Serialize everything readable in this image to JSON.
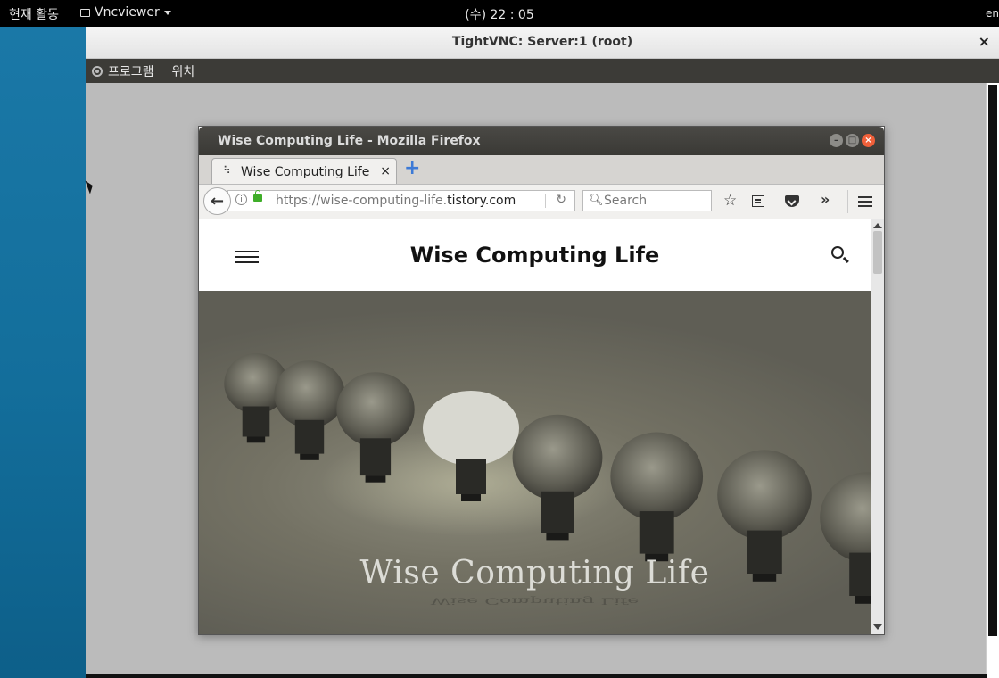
{
  "topbar": {
    "activities": "현재 활동",
    "app_menu": "Vncviewer",
    "clock": "(수) 22 : 05",
    "locale": "en"
  },
  "vnc": {
    "title": "TightVNC: Server:1 (root)",
    "close": "×",
    "panel_programs": "프로그램",
    "panel_places": "위치"
  },
  "firefox": {
    "title": "Wise Computing Life - Mozilla Firefox",
    "tab_label": "Wise Computing Life",
    "tab_close": "×",
    "url_prefix": "https://wise-computing-life.",
    "url_domain": "tistory.com",
    "search_placeholder": "Search",
    "more": "»"
  },
  "page": {
    "site_title": "Wise Computing Life",
    "hero_title": "Wise Computing Life"
  },
  "colors": {
    "desktop": "#1a78a7",
    "topbar": "#000000",
    "firefox_title": "#3a3935",
    "close_button": "#f0603a",
    "lock": "#3fae29",
    "new_tab": "#3d7ad6"
  }
}
